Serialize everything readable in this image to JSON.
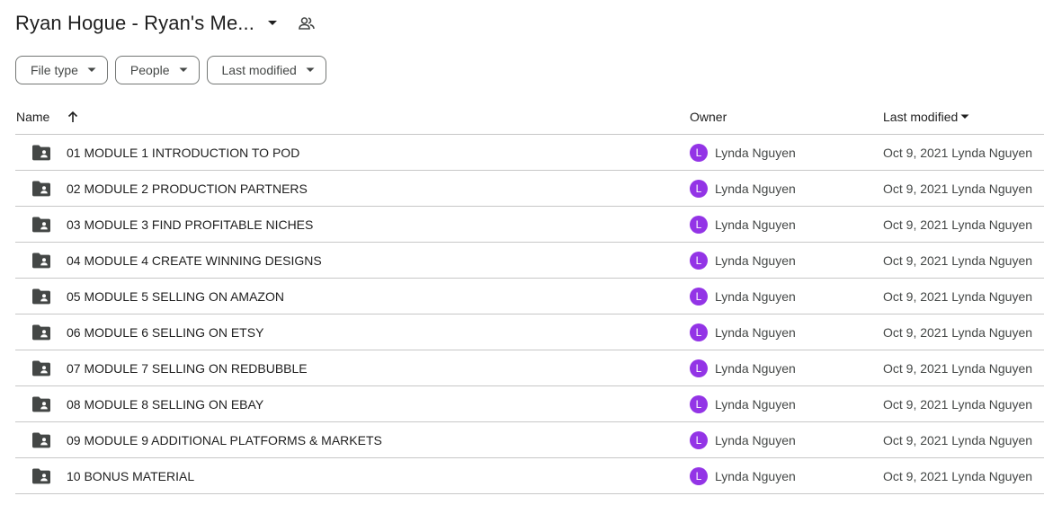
{
  "header": {
    "title": "Ryan Hogue - Ryan's Me...",
    "caret_icon": "arrow-drop-down-icon",
    "shared_icon": "people-icon"
  },
  "filters": [
    {
      "label": "File type"
    },
    {
      "label": "People"
    },
    {
      "label": "Last modified"
    }
  ],
  "columns": {
    "name": "Name",
    "owner": "Owner",
    "last_modified": "Last modified"
  },
  "rows": [
    {
      "name": "01 MODULE 1 INTRODUCTION TO POD",
      "owner_initial": "L",
      "owner": "Lynda Nguyen",
      "modified": "Oct 9, 2021 Lynda Nguyen"
    },
    {
      "name": "02 MODULE 2 PRODUCTION PARTNERS",
      "owner_initial": "L",
      "owner": "Lynda Nguyen",
      "modified": "Oct 9, 2021 Lynda Nguyen"
    },
    {
      "name": "03 MODULE 3 FIND PROFITABLE NICHES",
      "owner_initial": "L",
      "owner": "Lynda Nguyen",
      "modified": "Oct 9, 2021 Lynda Nguyen"
    },
    {
      "name": "04 MODULE 4 CREATE WINNING DESIGNS",
      "owner_initial": "L",
      "owner": "Lynda Nguyen",
      "modified": "Oct 9, 2021 Lynda Nguyen"
    },
    {
      "name": "05 MODULE 5 SELLING ON AMAZON",
      "owner_initial": "L",
      "owner": "Lynda Nguyen",
      "modified": "Oct 9, 2021 Lynda Nguyen"
    },
    {
      "name": "06 MODULE 6 SELLING ON ETSY",
      "owner_initial": "L",
      "owner": "Lynda Nguyen",
      "modified": "Oct 9, 2021 Lynda Nguyen"
    },
    {
      "name": "07 MODULE 7 SELLING ON REDBUBBLE",
      "owner_initial": "L",
      "owner": "Lynda Nguyen",
      "modified": "Oct 9, 2021 Lynda Nguyen"
    },
    {
      "name": "08 MODULE 8 SELLING ON EBAY",
      "owner_initial": "L",
      "owner": "Lynda Nguyen",
      "modified": "Oct 9, 2021 Lynda Nguyen"
    },
    {
      "name": "09 MODULE 9 ADDITIONAL PLATFORMS & MARKETS",
      "owner_initial": "L",
      "owner": "Lynda Nguyen",
      "modified": "Oct 9, 2021 Lynda Nguyen"
    },
    {
      "name": "10 BONUS MATERIAL",
      "owner_initial": "L",
      "owner": "Lynda Nguyen",
      "modified": "Oct 9, 2021 Lynda Nguyen"
    }
  ],
  "colors": {
    "avatar": "#9334e6",
    "divider": "#c7c7c7",
    "icon": "#444746"
  }
}
